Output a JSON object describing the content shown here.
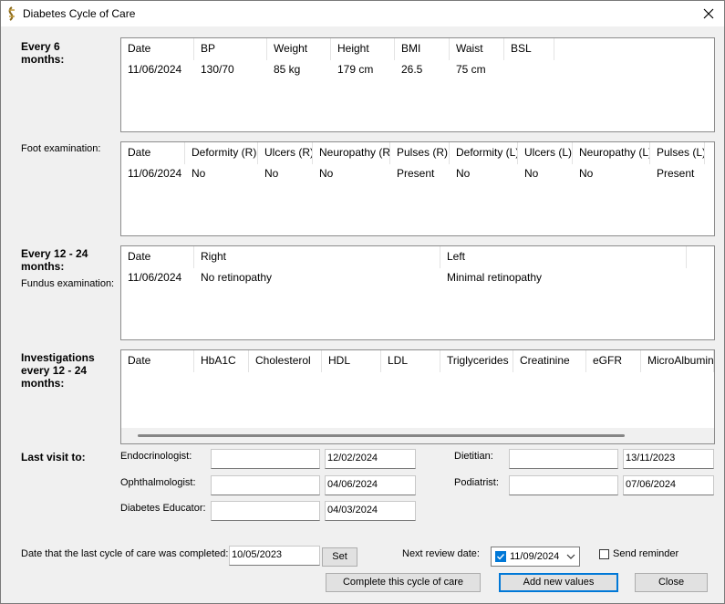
{
  "window": {
    "title": "Diabetes Cycle of Care"
  },
  "sections": {
    "every6": "Every 6 months:",
    "foot": "Foot examination:",
    "every12": "Every 12 - 24 months:",
    "fundus": "Fundus examination:",
    "investigations": "Investigations every 12 - 24 months:",
    "lastvisit": "Last visit to:"
  },
  "grid6": {
    "headers": [
      "Date",
      "BP",
      "Weight",
      "Height",
      "BMI",
      "Waist",
      "BSL"
    ],
    "rows": [
      [
        "11/06/2024",
        "130/70",
        "85 kg",
        "179 cm",
        "26.5",
        "75 cm",
        ""
      ]
    ]
  },
  "gridFoot": {
    "headers": [
      "Date",
      "Deformity (R)",
      "Ulcers (R)",
      "Neuropathy (R)",
      "Pulses (R)",
      "Deformity (L)",
      "Ulcers (L)",
      "Neuropathy (L)",
      "Pulses (L)"
    ],
    "rows": [
      [
        "11/06/2024",
        "No",
        "No",
        "No",
        "Present",
        "No",
        "No",
        "No",
        "Present"
      ]
    ]
  },
  "gridFundus": {
    "headers": [
      "Date",
      "Right",
      "Left"
    ],
    "rows": [
      [
        "11/06/2024",
        "No retinopathy",
        "Minimal retinopathy"
      ]
    ]
  },
  "gridInv": {
    "headers": [
      "Date",
      "HbA1C",
      "Cholesterol",
      "HDL",
      "LDL",
      "Triglycerides",
      "Creatinine",
      "eGFR",
      "MicroAlbuminu"
    ]
  },
  "visits": {
    "endo": {
      "label": "Endocrinologist:",
      "name": "",
      "date": "12/02/2024"
    },
    "ophth": {
      "label": "Ophthalmologist:",
      "name": "",
      "date": "04/06/2024"
    },
    "educ": {
      "label": "Diabetes Educator:",
      "name": "",
      "date": "04/03/2024"
    },
    "diet": {
      "label": "Dietitian:",
      "name": "",
      "date": "13/11/2023"
    },
    "podi": {
      "label": "Podiatrist:",
      "name": "",
      "date": "07/06/2024"
    }
  },
  "footer": {
    "completed_label": "Date that the last cycle of care was completed:",
    "completed_date": "10/05/2023",
    "set_label": "Set",
    "review_label": "Next review date:",
    "review_date": "11/09/2024",
    "review_checked": true,
    "send_reminder_label": "Send reminder",
    "send_reminder_checked": false,
    "complete_label": "Complete this cycle of care",
    "add_label": "Add new values",
    "close_label": "Close"
  },
  "colors": {
    "accent": "#0078d7",
    "window_bg": "#f0f0f0",
    "grid_bg": "#ffffff"
  }
}
